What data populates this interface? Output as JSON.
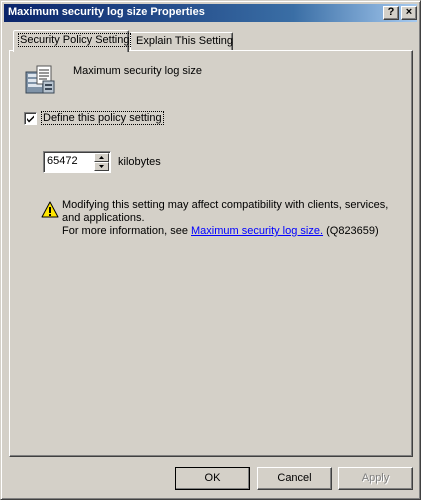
{
  "window": {
    "title": "Maximum security log size Properties",
    "help_button": "?",
    "close_button": "×"
  },
  "tabs": [
    {
      "label": "Security Policy Setting",
      "active": true
    },
    {
      "label": "Explain This Setting",
      "active": false
    }
  ],
  "policy": {
    "name": "Maximum security log size",
    "icon": "security-log-icon"
  },
  "define_checkbox": {
    "label": "Define this policy setting",
    "checked": true
  },
  "size_input": {
    "value": "65472",
    "unit": "kilobytes"
  },
  "warning": {
    "icon": "warning-icon",
    "text": "Modifying this setting may affect compatibility with clients, services, and applications.",
    "more_info_prefix": "For more information, see ",
    "link_text": "Maximum security log size.",
    "more_info_suffix": " (Q823659)"
  },
  "buttons": {
    "ok": "OK",
    "cancel": "Cancel",
    "apply": "Apply"
  }
}
